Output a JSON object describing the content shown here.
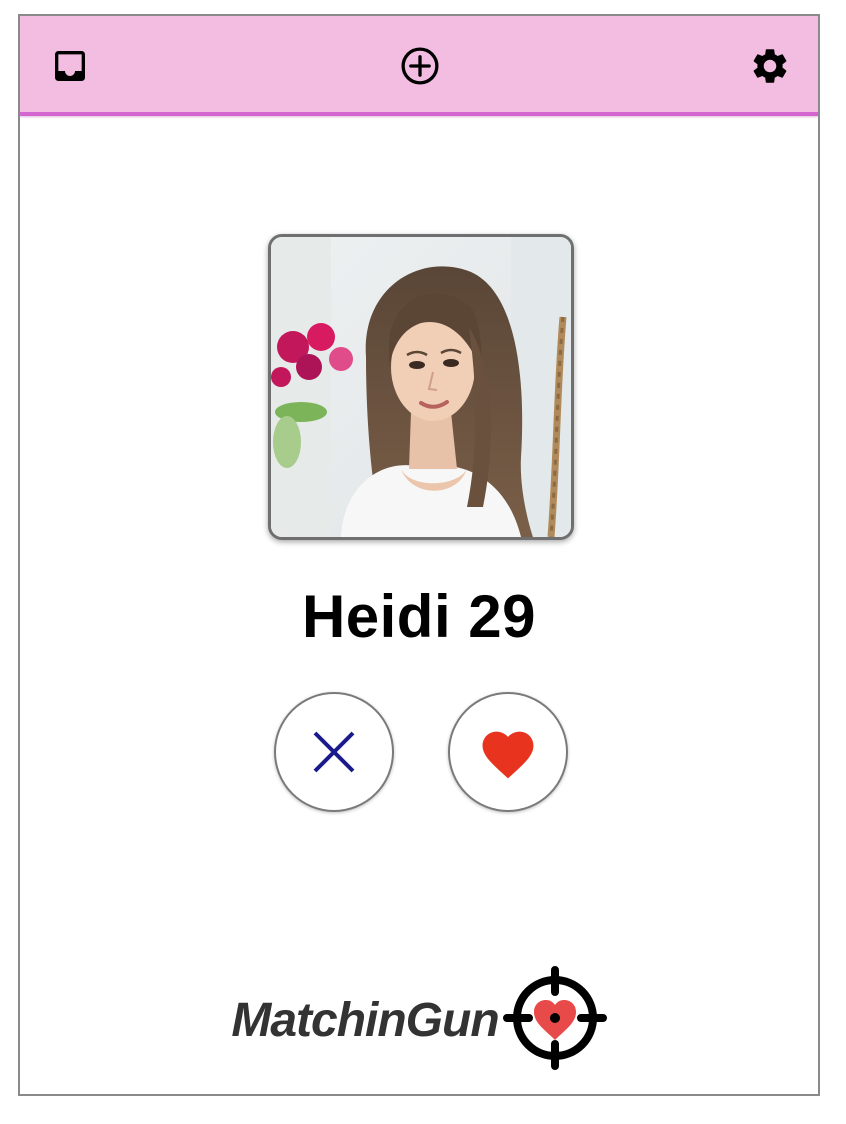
{
  "toolbar": {
    "icons": [
      "inbox-icon",
      "add-circle-icon",
      "gear-icon"
    ],
    "background_color": "#f2bde0",
    "accent_color": "#d566d0"
  },
  "profile": {
    "name_age": "Heidi 29"
  },
  "actions": {
    "reject_icon": "close-icon",
    "reject_color": "#1a1a8c",
    "like_icon": "heart-icon",
    "like_color": "#e8331f"
  },
  "brand": {
    "name": "MatchinGun",
    "logo_icon": "crosshair-heart-icon",
    "logo_heart_color": "#e84a4a"
  }
}
